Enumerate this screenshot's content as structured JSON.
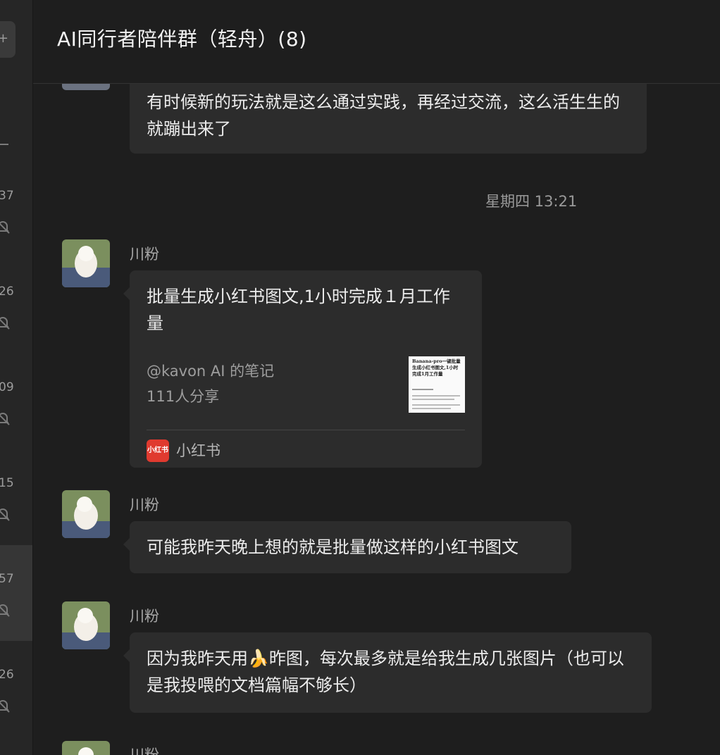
{
  "window": {
    "title": "AI同行者陪伴群（轻舟）(8)"
  },
  "sidebar": {
    "items": [
      {
        "time": "37"
      },
      {
        "time": "26"
      },
      {
        "time": "09"
      },
      {
        "time": "15"
      },
      {
        "time": "57"
      },
      {
        "time": "26"
      }
    ]
  },
  "messages": {
    "m0": {
      "text": "有时候新的玩法就是这么通过实践，再经过交流，这么活生生的就蹦出来了"
    },
    "timestamp": "星期四 13:21",
    "m1": {
      "sender": "川粉",
      "card": {
        "title": "批量生成小红书图文,1小时完成１月工作量",
        "author": "@kavon AI 的笔记",
        "shares": "111人分享",
        "source": "小红书",
        "logo_text": "小红书",
        "thumb_title": "Banana-pro一键批量生成小红书图文,1小时完成1月工作量"
      }
    },
    "m2": {
      "sender": "川粉",
      "text": "可能我昨天晚上想的就是批量做这样的小红书图文"
    },
    "m3": {
      "sender": "川粉",
      "text_before": "因为我昨天用",
      "emoji": "🍌",
      "text_after": "昨图，每次最多就是给我生成几张图片（也可以是我投喂的文档篇幅不够长）"
    },
    "m4": {
      "sender": "川粉"
    }
  },
  "colors": {
    "background": "#1e1e1e",
    "bubble": "#2c2c2c",
    "sidebar": "#262626",
    "xhs_brand": "#e03a2f"
  }
}
